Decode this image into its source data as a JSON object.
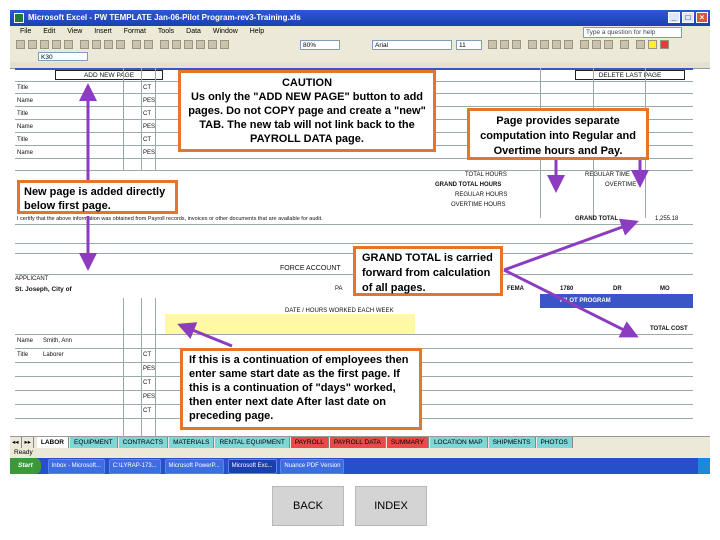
{
  "window": {
    "title": "Microsoft Excel - PW TEMPLATE Jan-06-Pilot Program-rev3-Training.xls",
    "help_placeholder": "Type a question for help"
  },
  "menu": [
    "File",
    "Edit",
    "View",
    "Insert",
    "Format",
    "Tools",
    "Data",
    "Window",
    "Help"
  ],
  "toolbar": {
    "zoom": "80%",
    "font": "Arial",
    "font_size": "11"
  },
  "formula_bar": {
    "name_box": "K30"
  },
  "sheet": {
    "add_new_page": "ADD NEW PAGE",
    "delete_last_page": "DELETE LAST PAGE",
    "row_labels": [
      "Title",
      "Name",
      "Title",
      "Name",
      "Title",
      "Name"
    ],
    "codes": [
      "CT",
      "PES",
      "CT",
      "PES",
      "CT",
      "PES"
    ],
    "totals": {
      "total_hours": "TOTAL HOURS",
      "grand_total_hours": "GRAND TOTAL HOURS",
      "regular_hours": "REGULAR HOURS",
      "overtime_hours": "OVERTIME HOURS",
      "regular_time": "REGULAR TIME",
      "overtime": "OVERTIME",
      "grand_total": "GRAND TOTAL",
      "grand_total_value": "1,255.18"
    },
    "certify_text": "I certify that the above information was obtained from Payroll records, invoices or other documents that are available for audit.",
    "applicant_label": "APPLICANT",
    "applicant_value": "St. Joseph, City of",
    "force_account": "FORCE ACCOUNT",
    "pa_label": "PA",
    "fema": "FEMA",
    "fema_no": "1780",
    "dr": "DR",
    "state": "MO",
    "date_hours_header": "DATE / HOURS WORKED EACH WEEK",
    "total_cost": "TOTAL COST",
    "employee_name": "Smith, Ann",
    "employee_title": "Laborer",
    "pilot_program_label": "PILOT PROGRAM"
  },
  "sheet_tabs": [
    "LABOR",
    "EQUIPMENT",
    "CONTRACTS",
    "MATERIALS",
    "RENTAL EQUIPMENT",
    "PAYROLL",
    "PAYROLL DATA",
    "SUMMARY",
    "LOCATION MAP",
    "SHIPMENTS",
    "PHOTOS"
  ],
  "status": "Ready",
  "taskbar": {
    "start": "Start",
    "tasks": [
      "Inbox - Microsoft...",
      "C:\\LYRAP-173...",
      "Microsoft PowerP...",
      "Microsoft Exc...",
      "Nuance PDF Version"
    ]
  },
  "callouts": {
    "caution": "CAUTION\nUs only the \"ADD NEW PAGE\" button to add pages. Do not COPY page and create a \"new\" TAB. The new tab will not link back to the PAYROLL DATA page.",
    "page_computation": "Page provides separate computation into Regular and Overtime hours and Pay.",
    "new_page": "New page is added directly below first page.",
    "grand_total": "GRAND TOTAL is carried forward from calculation of all pages.",
    "continuation": "If this is a continuation of employees then enter same start date as the first page. If this is a continuation of \"days\" worked, then enter next date After last date on preceding page."
  },
  "nav": {
    "back": "BACK",
    "index": "INDEX"
  },
  "colors": {
    "callout_border": "#e8742a",
    "arrow": "#8b3cc0",
    "excel_title": "#2a5ad7",
    "band_blue": "#3a55c8"
  }
}
